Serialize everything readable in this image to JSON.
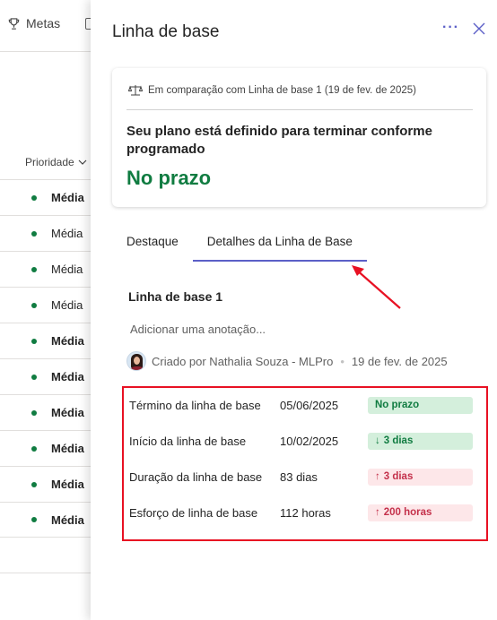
{
  "background": {
    "tab_metas": "Metas",
    "column_header": "Prioridade",
    "rows": [
      {
        "label": "Média",
        "bold": true
      },
      {
        "label": "Média",
        "bold": false
      },
      {
        "label": "Média",
        "bold": false
      },
      {
        "label": "Média",
        "bold": false
      },
      {
        "label": "Média",
        "bold": true
      },
      {
        "label": "Média",
        "bold": true
      },
      {
        "label": "Média",
        "bold": true
      },
      {
        "label": "Média",
        "bold": true
      },
      {
        "label": "Média",
        "bold": true
      },
      {
        "label": "Média",
        "bold": true
      }
    ]
  },
  "panel": {
    "title": "Linha de base",
    "more_label": "···",
    "card": {
      "comparison": "Em comparação com Linha de base 1 (19 de fev. de 2025)",
      "message": "Seu plano está definido para terminar conforme programado",
      "status": "No prazo"
    },
    "tabs": [
      {
        "label": "Destaque",
        "active": false
      },
      {
        "label": "Detalhes da Linha de Base",
        "active": true
      }
    ],
    "baseline_title": "Linha de base 1",
    "annotation_placeholder": "Adicionar uma anotação...",
    "creator": "Criado por Nathalia Souza - MLPro",
    "created_date": "19 de fev. de 2025",
    "details": [
      {
        "label": "Término da linha de base",
        "value": "05/06/2025",
        "badge": "No prazo",
        "badge_type": "green",
        "badge_icon": ""
      },
      {
        "label": "Início da linha de base",
        "value": "10/02/2025",
        "badge": "3 dias",
        "badge_type": "green",
        "badge_icon": "↓"
      },
      {
        "label": "Duração da linha de base",
        "value": "83 dias",
        "badge": "3 dias",
        "badge_type": "red",
        "badge_icon": "↑"
      },
      {
        "label": "Esforço de linha de base",
        "value": "112 horas",
        "badge": "200 horas",
        "badge_type": "red",
        "badge_icon": "↑"
      }
    ]
  },
  "colors": {
    "accent": "#5b5fc7",
    "on_time_green": "#107c41",
    "highlight_red": "#e81123"
  }
}
